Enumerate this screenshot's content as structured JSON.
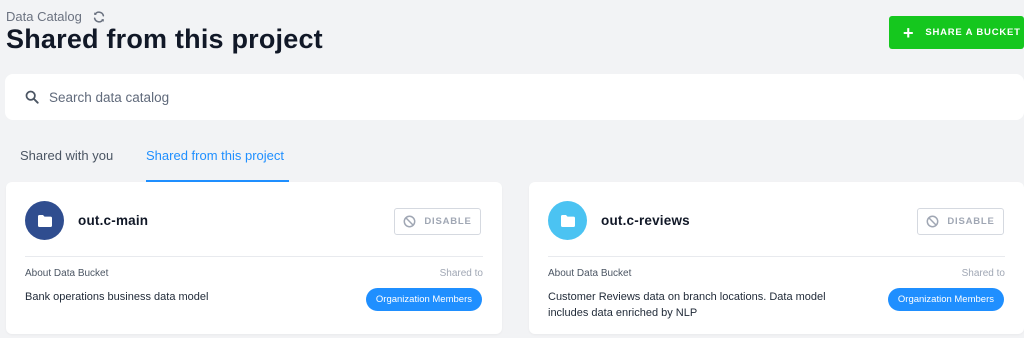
{
  "header": {
    "breadcrumb": "Data Catalog",
    "title": "Shared from this project",
    "share_button_label": "SHARE A BUCKET"
  },
  "search": {
    "placeholder": "Search data catalog",
    "value": ""
  },
  "tabs": [
    {
      "label": "Shared with you",
      "active": false
    },
    {
      "label": "Shared from this project",
      "active": true
    }
  ],
  "buckets": [
    {
      "name": "out.c-main",
      "disable_label": "DISABLE",
      "about_label": "About Data Bucket",
      "shared_to_label": "Shared to",
      "description": "Bank operations business data model",
      "shared_to_badge": "Organization Members",
      "avatar_color": "#2f4d8f"
    },
    {
      "name": "out.c-reviews",
      "disable_label": "DISABLE",
      "about_label": "About Data Bucket",
      "shared_to_label": "Shared to",
      "description": "Customer Reviews data on branch locations. Data model includes data enriched by NLP",
      "shared_to_badge": "Organization Members",
      "avatar_color": "#4bc3f2"
    }
  ],
  "icons": {
    "refresh": "refresh-icon",
    "plus": "plus-icon",
    "search": "search-icon",
    "folder": "folder-icon",
    "disable": "ban-icon"
  },
  "colors": {
    "accent": "#1f8fff",
    "primary_button": "#15c71e",
    "background": "#f2f3f5"
  }
}
